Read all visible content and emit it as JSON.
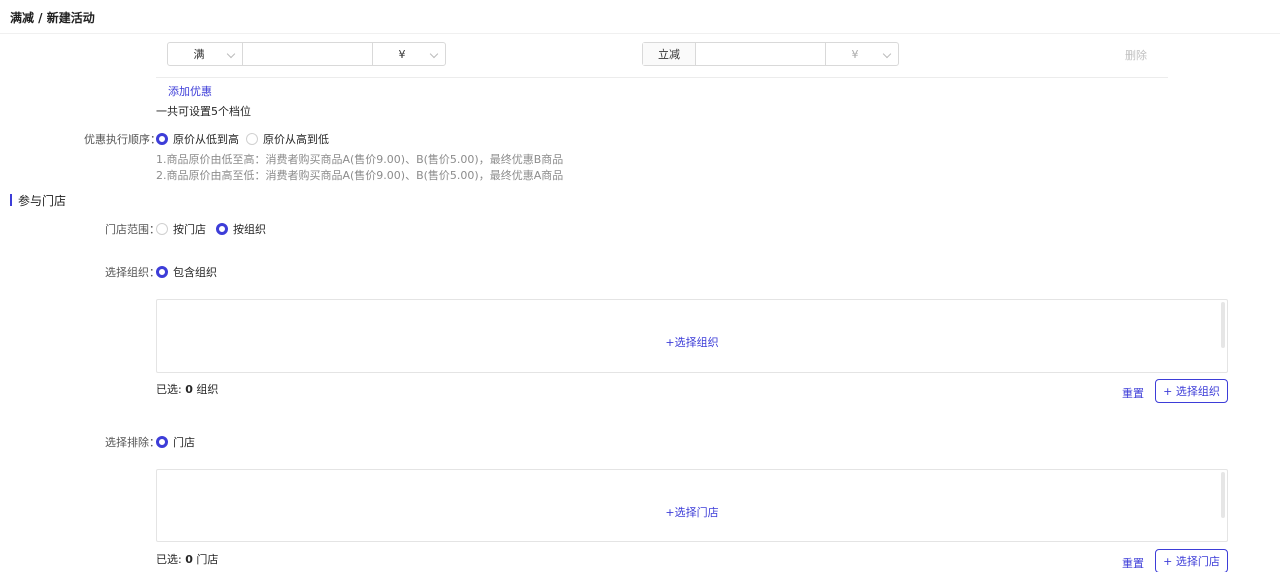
{
  "header": {
    "title": "满减 / 新建活动"
  },
  "tier_row": {
    "condition_select": "满",
    "condition_amount_value": "",
    "currency_select": "¥",
    "action_select": "立减",
    "action_amount_value": "",
    "action_currency_select": "¥",
    "delete_label": "删除"
  },
  "add_discount_label": "添加优惠",
  "tier_limit_text": "一共可设置5个档位",
  "execution_order": {
    "label": "优惠执行顺序：",
    "options": [
      "原价从低到高",
      "原价从高到低"
    ],
    "selected": "原价从低到高",
    "notes": [
      "1.商品原价由低至高：消费者购买商品A(售价9.00)、B(售价5.00)，最终优惠B商品",
      "2.商品原价由高至低：消费者购买商品A(售价9.00)、B(售价5.00)，最终优惠A商品"
    ]
  },
  "stores_section": {
    "title": "参与门店",
    "scope": {
      "label": "门店范围：",
      "options": [
        "按门店",
        "按组织"
      ],
      "selected": "按组织"
    },
    "org_select": {
      "label": "选择组织：",
      "option": "包含组织",
      "picker_link": "+选择组织",
      "selected_prefix": "已选: ",
      "selected_count": "0",
      "selected_suffix": " 组织",
      "reset_label": "重置",
      "select_button": "+ 选择组织"
    },
    "exclude_select": {
      "label": "选择排除：",
      "option": "门店",
      "picker_link": "+选择门店",
      "selected_prefix": "已选: ",
      "selected_count": "0",
      "selected_suffix": " 门店",
      "reset_label": "重置",
      "select_button": "+ 选择门店"
    }
  },
  "colors": {
    "accent": "#3d3dd8",
    "border": "#d9d9d9",
    "hint": "#8c8c8c"
  }
}
